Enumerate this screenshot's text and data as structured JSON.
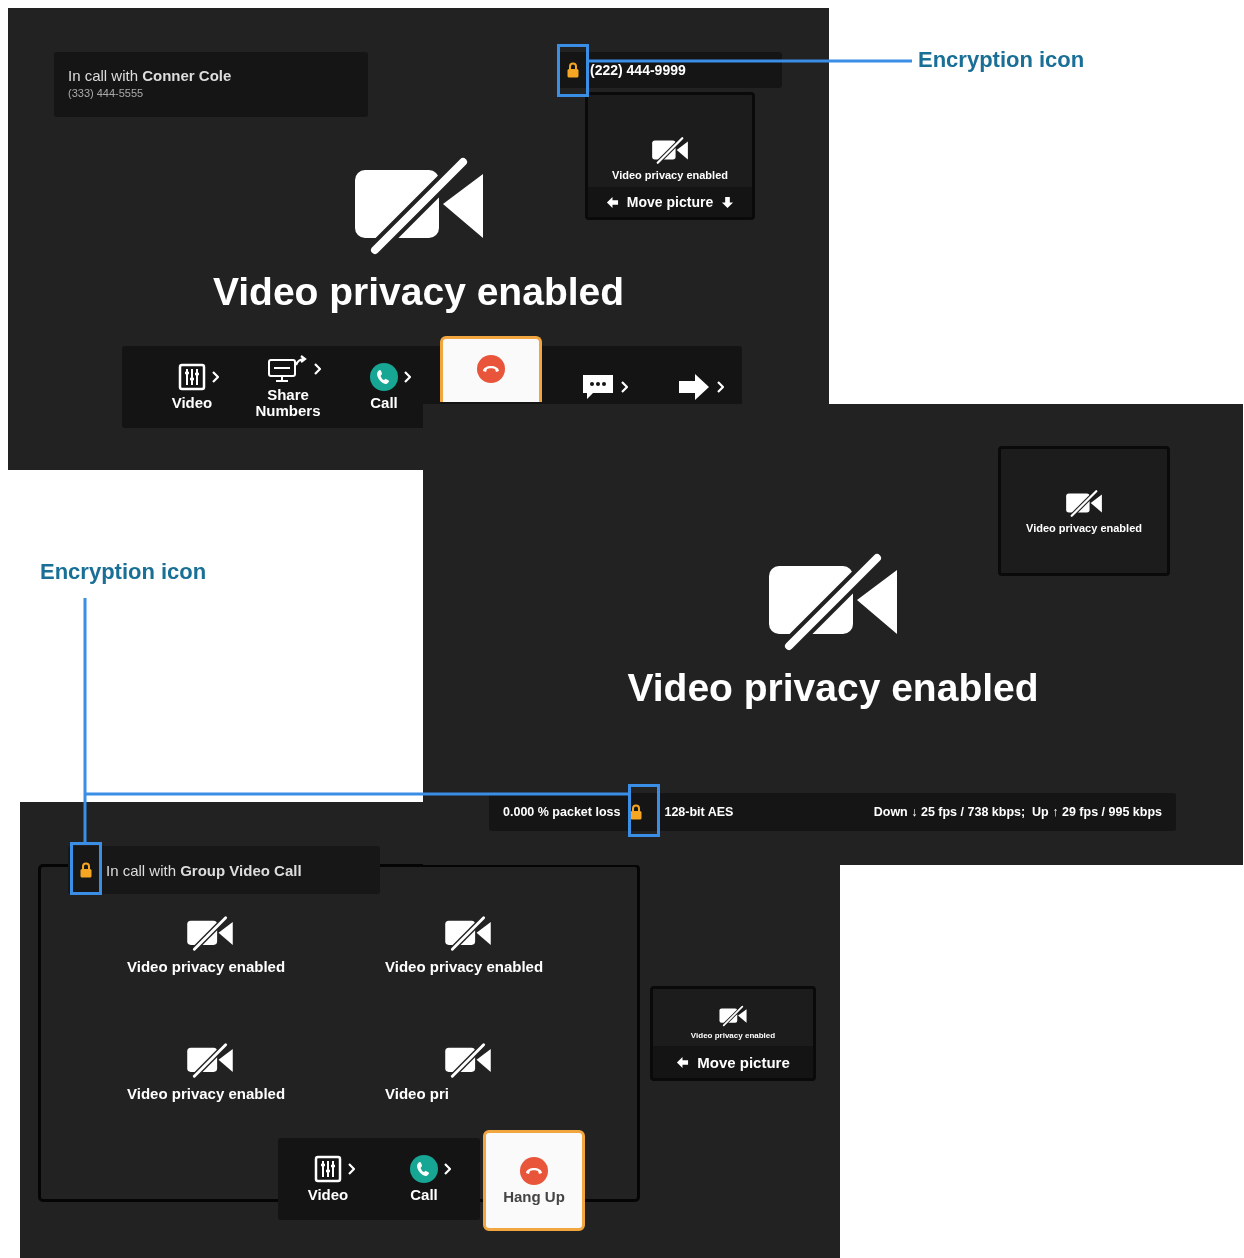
{
  "callouts": [
    {
      "label": "Encryption icon"
    },
    {
      "label": "Encryption icon"
    }
  ],
  "call_screen": {
    "caller": {
      "text": "In call with **Conner Cole**",
      "number": "(333) 444-5555"
    },
    "remote": {
      "encrypted": true,
      "number": "(222) 444-9999"
    },
    "self_view": {
      "label": "Video privacy enabled",
      "move_label": "Move picture",
      "arrow_left": true,
      "arrow_down": true
    },
    "message": "Video privacy enabled",
    "toolbar": [
      {
        "kind": "video",
        "label": "Video",
        "selected": false
      },
      {
        "kind": "share",
        "label": "Share Numbers",
        "selected": false
      },
      {
        "kind": "call",
        "label": "Call",
        "selected": false
      },
      {
        "kind": "hangup",
        "selected": true
      },
      {
        "kind": "text",
        "selected": false
      },
      {
        "kind": "transfer",
        "selected": false
      }
    ]
  },
  "stats_screen": {
    "self_view": {
      "label": "Video privacy enabled"
    },
    "message": "Video privacy enabled",
    "status_bar": {
      "packet_loss": "0.000 % packet loss",
      "encrypted": true,
      "encryption": "128-bit AES",
      "rates": "Down ↓ 25 fps / 738 kbps;  Up ↑ 29 fps / 995 kbps"
    }
  },
  "group_screen": {
    "header": {
      "encrypted": true,
      "text": "In call with **Group Video Call**"
    },
    "tiles": [
      {
        "label": "Video privacy enabled"
      },
      {
        "label": "Video privacy enabled"
      },
      {
        "label": "Video privacy enabled"
      },
      {
        "label": "Video pri"
      }
    ],
    "self_view": {
      "label": "Video privacy enabled",
      "move_label": "Move picture",
      "arrow_left": true
    },
    "toolbar": [
      {
        "kind": "video",
        "label": "Video",
        "selected": false
      },
      {
        "kind": "call",
        "label": "Call",
        "selected": false
      },
      {
        "kind": "hangup",
        "label": "Hang Up",
        "selected": true
      }
    ]
  }
}
